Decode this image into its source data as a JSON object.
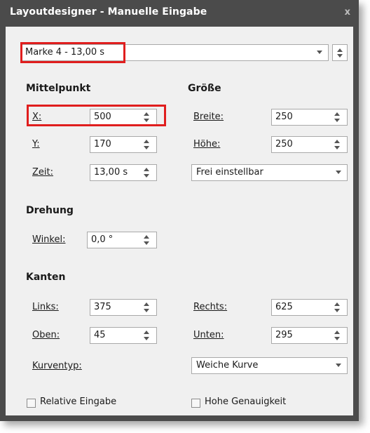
{
  "window": {
    "title": "Layoutdesigner - Manuelle Eingabe",
    "close_label": "x"
  },
  "marker_select": {
    "value": "Marke 4 - 13,00 s"
  },
  "center": {
    "header": "Mittelpunkt",
    "x": {
      "label": "X:",
      "value": "500"
    },
    "y": {
      "label": "Y:",
      "value": "170"
    },
    "time": {
      "label": "Zeit:",
      "value": "13,00 s"
    }
  },
  "size": {
    "header": "Größe",
    "width": {
      "label": "Breite:",
      "value": "250"
    },
    "height": {
      "label": "Höhe:",
      "value": "250"
    },
    "mode": {
      "value": "Frei einstellbar"
    }
  },
  "rotation": {
    "header": "Drehung",
    "angle": {
      "label": "Winkel:",
      "value": "0,0 °"
    }
  },
  "edges": {
    "header": "Kanten",
    "left": {
      "label": "Links:",
      "value": "375"
    },
    "right": {
      "label": "Rechts:",
      "value": "625"
    },
    "top": {
      "label": "Oben:",
      "value": "45"
    },
    "bottom": {
      "label": "Unten:",
      "value": "295"
    },
    "curve_type": {
      "label": "Kurventyp:",
      "value": "Weiche Kurve"
    }
  },
  "options": {
    "relative_input": {
      "label": "Relative Eingabe",
      "checked": false
    },
    "high_precision": {
      "label": "Hohe Genauigkeit",
      "checked": false
    }
  },
  "colors": {
    "titlebar": "#4b4b4b",
    "highlight": "#e01e1e",
    "panel": "#f0f0f0"
  }
}
